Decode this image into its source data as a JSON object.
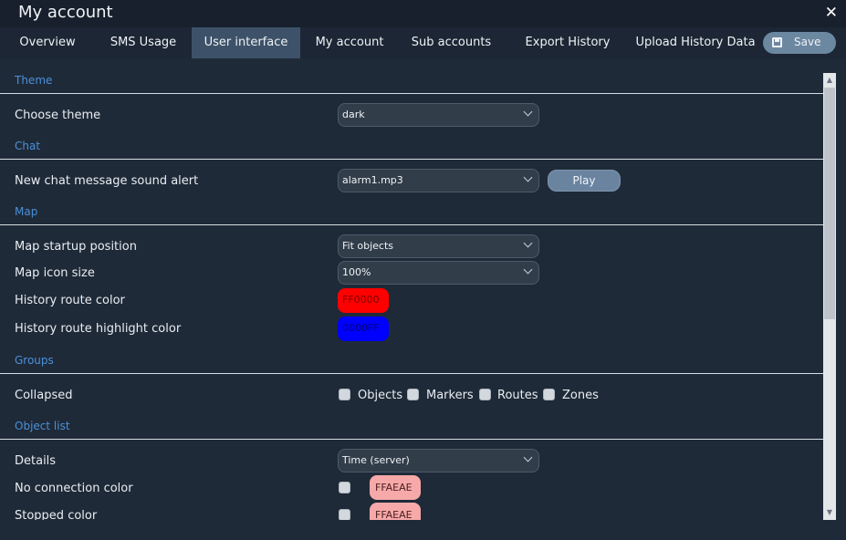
{
  "window": {
    "title": "My account",
    "close_glyph": "✕"
  },
  "tabs": [
    {
      "label": "Overview"
    },
    {
      "label": "SMS Usage"
    },
    {
      "label": "User interface"
    },
    {
      "label": "My account"
    },
    {
      "label": "Sub accounts"
    },
    {
      "label": "Export History"
    },
    {
      "label": "Upload History Data"
    }
  ],
  "active_tab": "User interface",
  "toolbar": {
    "save_label": "Save",
    "save_icon": "floppy-disk-icon"
  },
  "sections": {
    "theme": {
      "title": "Theme",
      "choose_theme": {
        "label": "Choose theme",
        "value": "dark"
      }
    },
    "chat": {
      "title": "Chat",
      "sound_alert": {
        "label": "New chat message sound alert",
        "value": "alarm1.mp3",
        "play_label": "Play"
      }
    },
    "map": {
      "title": "Map",
      "startup_position": {
        "label": "Map startup position",
        "value": "Fit objects"
      },
      "icon_size": {
        "label": "Map icon size",
        "value": "100%"
      },
      "route_color": {
        "label": "History route color",
        "value": "FF0000",
        "color": "#ff0000"
      },
      "route_highlight_color": {
        "label": "History route highlight color",
        "value": "0000FF",
        "color": "#0000ff"
      }
    },
    "groups": {
      "title": "Groups",
      "collapsed": {
        "label": "Collapsed",
        "options": [
          {
            "label": "Objects",
            "checked": false
          },
          {
            "label": "Markers",
            "checked": false
          },
          {
            "label": "Routes",
            "checked": false
          },
          {
            "label": "Zones",
            "checked": false
          }
        ]
      }
    },
    "object_list": {
      "title": "Object list",
      "details": {
        "label": "Details",
        "value": "Time (server)"
      },
      "no_connection_color": {
        "label": "No connection color",
        "value": "FFAEAE",
        "checked": false
      },
      "stopped_color": {
        "label": "Stopped color",
        "value": "FFAEAE",
        "checked": false
      }
    }
  },
  "colors": {
    "accent": "#4a90d9",
    "active_tab": "#3d5268",
    "background": "#1f2a38",
    "pink_swatch": "#f7a9a9"
  }
}
